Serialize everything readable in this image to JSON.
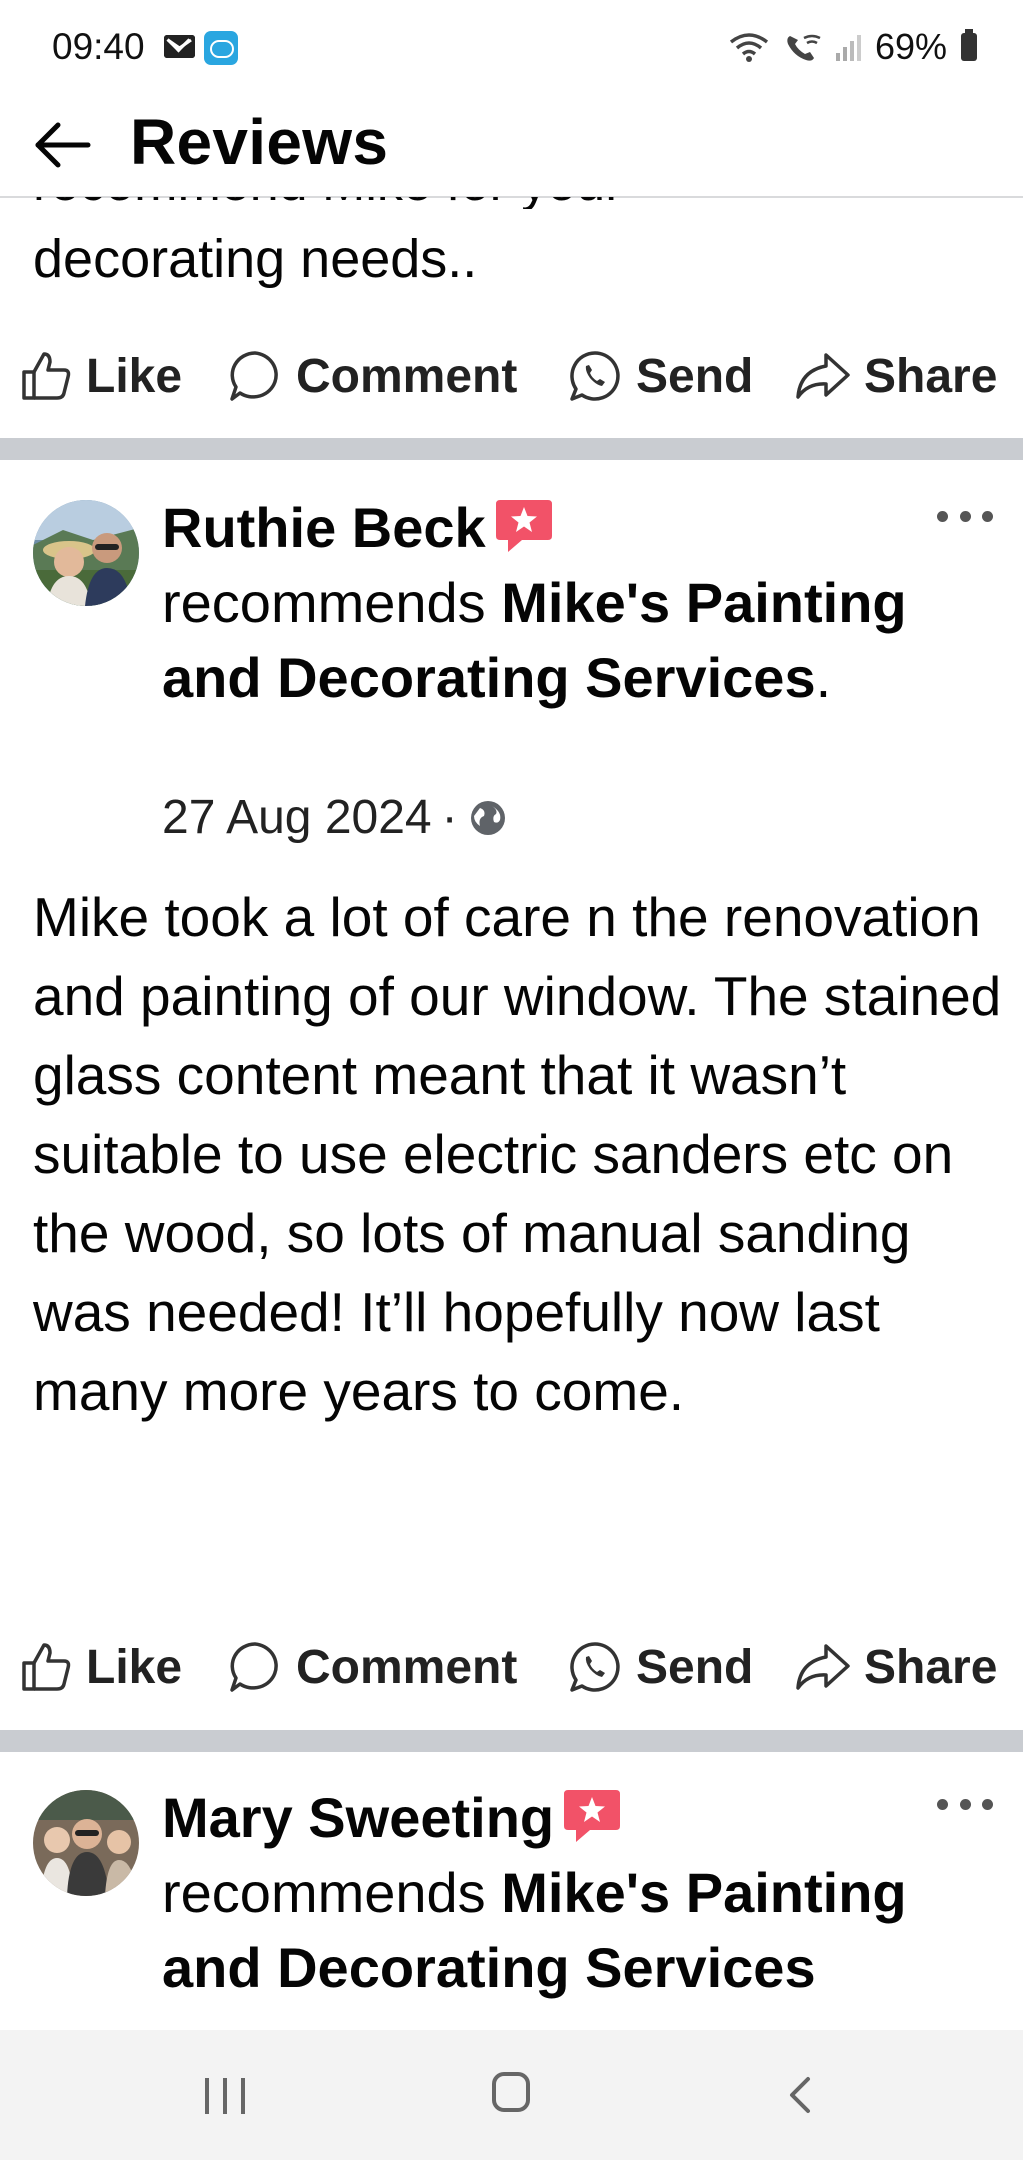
{
  "status_bar": {
    "time": "09:40",
    "battery": "69%",
    "icons": [
      "mail-icon",
      "box-app-icon",
      "wifi-icon",
      "wifi-call-icon",
      "signal-icon",
      "battery-icon"
    ]
  },
  "header": {
    "title": "Reviews",
    "back_icon": "back-arrow-icon"
  },
  "previous_post": {
    "clipped_line": "recommend Mike for your",
    "last_line": "decorating needs.."
  },
  "actions": {
    "like": "Like",
    "comment": "Comment",
    "send": "Send",
    "share": "Share"
  },
  "posts": [
    {
      "author": "Ruthie Beck",
      "recommends": "recommends",
      "page_name": "Mike's Painting and Decorating Services",
      "period": ".",
      "date": "27 Aug 2024",
      "separator": "·",
      "privacy_icon": "globe-icon",
      "body": "Mike took a lot of care n the renovation and painting of our window. The stained glass content meant that it wasn’t suitable to use electric sanders etc on the wood, so lots of manual sanding was needed! It’ll hopefully now last many more years to come."
    },
    {
      "author": "Mary Sweeting",
      "recommends": "recommends",
      "page_name": "Mike's Painting and Decorating Services"
    }
  ],
  "colors": {
    "divider": "#c9ccd1",
    "recommend_badge": "#f25268",
    "text": "#050505",
    "nav_background": "#f3f3f3"
  },
  "nav_bar": {
    "icons": [
      "recent-apps-icon",
      "home-icon",
      "back-icon"
    ]
  }
}
